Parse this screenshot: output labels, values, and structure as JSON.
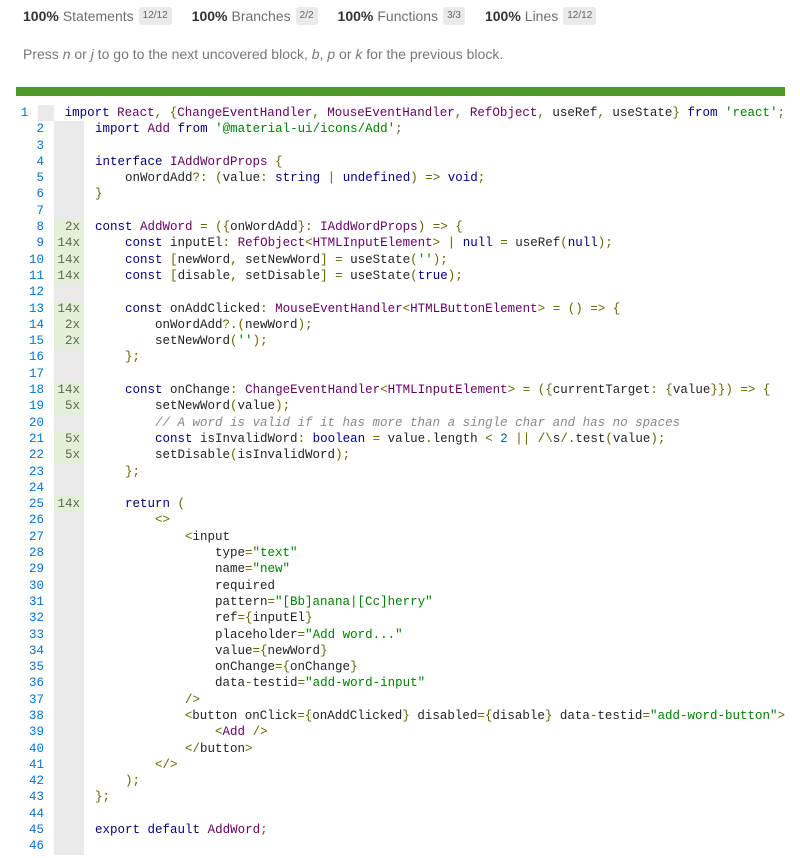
{
  "summary": {
    "statements": {
      "pct": "100%",
      "label": "Statements",
      "frac": "12/12"
    },
    "branches": {
      "pct": "100%",
      "label": "Branches",
      "frac": "2/2"
    },
    "functions": {
      "pct": "100%",
      "label": "Functions",
      "frac": "3/3"
    },
    "lines": {
      "pct": "100%",
      "label": "Lines",
      "frac": "12/12"
    }
  },
  "hint": {
    "t1": "Press ",
    "k1": "n",
    "t2": " or ",
    "k2": "j",
    "t3": " to go to the next uncovered block, ",
    "k3": "b",
    "t4": ", ",
    "k4": "p",
    "t5": " or ",
    "k5": "k",
    "t6": " for the previous block."
  },
  "colors": {
    "covered": "#4d9a2a",
    "hit_bg": "#e3efd9",
    "line_number": "#0074d9"
  },
  "lines": [
    {
      "n": "1",
      "count": "",
      "code": "import React, {ChangeEventHandler, MouseEventHandler, RefObject, useRef, useState} from 'react';"
    },
    {
      "n": "2",
      "count": "",
      "code": "import Add from '@material-ui/icons/Add';"
    },
    {
      "n": "3",
      "count": "",
      "code": ""
    },
    {
      "n": "4",
      "count": "",
      "code": "interface IAddWordProps {"
    },
    {
      "n": "5",
      "count": "",
      "code": "    onWordAdd?: (value: string | undefined) => void;"
    },
    {
      "n": "6",
      "count": "",
      "code": "}"
    },
    {
      "n": "7",
      "count": "",
      "code": ""
    },
    {
      "n": "8",
      "count": "2x",
      "code": "const AddWord = ({onWordAdd}: IAddWordProps) => {"
    },
    {
      "n": "9",
      "count": "14x",
      "code": "    const inputEl: RefObject<HTMLInputElement> | null = useRef(null);"
    },
    {
      "n": "10",
      "count": "14x",
      "code": "    const [newWord, setNewWord] = useState('');"
    },
    {
      "n": "11",
      "count": "14x",
      "code": "    const [disable, setDisable] = useState(true);"
    },
    {
      "n": "12",
      "count": "",
      "code": ""
    },
    {
      "n": "13",
      "count": "14x",
      "code": "    const onAddClicked: MouseEventHandler<HTMLButtonElement> = () => {"
    },
    {
      "n": "14",
      "count": "2x",
      "code": "        onWordAdd?.(newWord);"
    },
    {
      "n": "15",
      "count": "2x",
      "code": "        setNewWord('');"
    },
    {
      "n": "16",
      "count": "",
      "code": "    };"
    },
    {
      "n": "17",
      "count": "",
      "code": ""
    },
    {
      "n": "18",
      "count": "14x",
      "code": "    const onChange: ChangeEventHandler<HTMLInputElement> = ({currentTarget: {value}}) => {"
    },
    {
      "n": "19",
      "count": "5x",
      "code": "        setNewWord(value);"
    },
    {
      "n": "20",
      "count": "",
      "code": "        // A word is valid if it has more than a single char and has no spaces"
    },
    {
      "n": "21",
      "count": "5x",
      "code": "        const isInvalidWord: boolean = value.length < 2 || /\\s/.test(value);"
    },
    {
      "n": "22",
      "count": "5x",
      "code": "        setDisable(isInvalidWord);"
    },
    {
      "n": "23",
      "count": "",
      "code": "    };"
    },
    {
      "n": "24",
      "count": "",
      "code": ""
    },
    {
      "n": "25",
      "count": "14x",
      "code": "    return ("
    },
    {
      "n": "26",
      "count": "",
      "code": "        <>"
    },
    {
      "n": "27",
      "count": "",
      "code": "            <input"
    },
    {
      "n": "28",
      "count": "",
      "code": "                type=\"text\""
    },
    {
      "n": "29",
      "count": "",
      "code": "                name=\"new\""
    },
    {
      "n": "30",
      "count": "",
      "code": "                required"
    },
    {
      "n": "31",
      "count": "",
      "code": "                pattern=\"[Bb]anana|[Cc]herry\""
    },
    {
      "n": "32",
      "count": "",
      "code": "                ref={inputEl}"
    },
    {
      "n": "33",
      "count": "",
      "code": "                placeholder=\"Add word...\""
    },
    {
      "n": "34",
      "count": "",
      "code": "                value={newWord}"
    },
    {
      "n": "35",
      "count": "",
      "code": "                onChange={onChange}"
    },
    {
      "n": "36",
      "count": "",
      "code": "                data-testid=\"add-word-input\""
    },
    {
      "n": "37",
      "count": "",
      "code": "            />"
    },
    {
      "n": "38",
      "count": "",
      "code": "            <button onClick={onAddClicked} disabled={disable} data-testid=\"add-word-button\">"
    },
    {
      "n": "39",
      "count": "",
      "code": "                <Add />"
    },
    {
      "n": "40",
      "count": "",
      "code": "            </button>"
    },
    {
      "n": "41",
      "count": "",
      "code": "        </>"
    },
    {
      "n": "42",
      "count": "",
      "code": "    );"
    },
    {
      "n": "43",
      "count": "",
      "code": "};"
    },
    {
      "n": "44",
      "count": "",
      "code": ""
    },
    {
      "n": "45",
      "count": "",
      "code": "export default AddWord;"
    },
    {
      "n": "46",
      "count": "",
      "code": ""
    }
  ]
}
